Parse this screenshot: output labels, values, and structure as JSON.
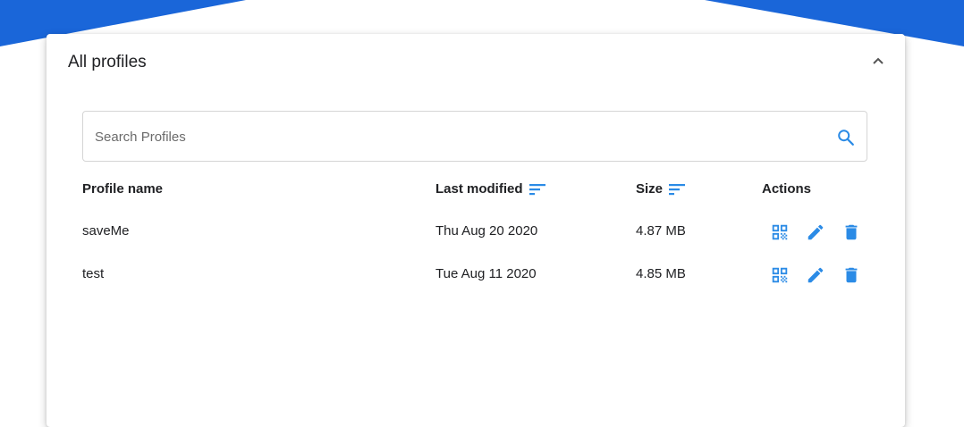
{
  "colors": {
    "accent": "#1a66d9",
    "icon_blue": "#2b8be6",
    "sort_blue": "#2b8be6"
  },
  "panel": {
    "title": "All profiles",
    "collapse_icon": "chevron-up-icon"
  },
  "search": {
    "placeholder": "Search Profiles",
    "value": "",
    "icon": "search-icon"
  },
  "table": {
    "columns": [
      {
        "label": "Profile name",
        "sortable": false
      },
      {
        "label": "Last modified",
        "sortable": true
      },
      {
        "label": "Size",
        "sortable": true
      },
      {
        "label": "Actions",
        "sortable": false
      }
    ],
    "rows": [
      {
        "name": "saveMe",
        "modified": "Thu Aug 20 2020",
        "size": "4.87 MB",
        "actions": [
          "qr-code-icon",
          "edit-icon",
          "delete-icon"
        ]
      },
      {
        "name": "test",
        "modified": "Tue Aug 11 2020",
        "size": "4.85 MB",
        "actions": [
          "qr-code-icon",
          "edit-icon",
          "delete-icon"
        ]
      }
    ]
  }
}
